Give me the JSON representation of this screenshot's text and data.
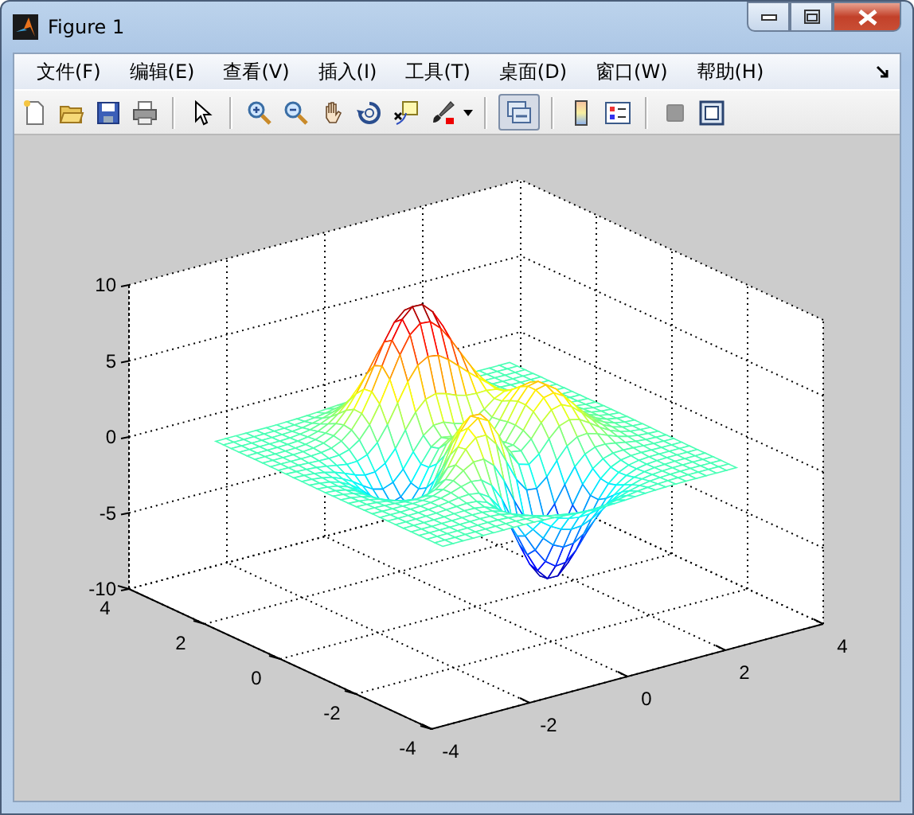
{
  "window": {
    "title": "Figure 1"
  },
  "menu": [
    {
      "label": "文件(F)"
    },
    {
      "label": "编辑(E)"
    },
    {
      "label": "查看(V)"
    },
    {
      "label": "插入(I)"
    },
    {
      "label": "工具(T)"
    },
    {
      "label": "桌面(D)"
    },
    {
      "label": "窗口(W)"
    },
    {
      "label": "帮助(H)"
    }
  ],
  "toolbar": [
    {
      "kind": "new",
      "pressed": false
    },
    {
      "kind": "open",
      "pressed": false
    },
    {
      "kind": "save",
      "pressed": false
    },
    {
      "kind": "print",
      "pressed": false
    },
    {
      "kind": "separator"
    },
    {
      "kind": "pointer",
      "pressed": false
    },
    {
      "kind": "separator"
    },
    {
      "kind": "zoom-in",
      "pressed": false
    },
    {
      "kind": "zoom-out",
      "pressed": false
    },
    {
      "kind": "pan",
      "pressed": false
    },
    {
      "kind": "rotate",
      "pressed": false
    },
    {
      "kind": "data-cursor",
      "pressed": false
    },
    {
      "kind": "brush",
      "pressed": false
    },
    {
      "kind": "separator"
    },
    {
      "kind": "link",
      "pressed": true
    },
    {
      "kind": "separator"
    },
    {
      "kind": "colorbar",
      "pressed": false
    },
    {
      "kind": "legend",
      "pressed": false
    },
    {
      "kind": "separator"
    },
    {
      "kind": "hide-tools",
      "pressed": false
    },
    {
      "kind": "show-tools",
      "pressed": false
    }
  ],
  "axes": {
    "z_ticks": [
      "10",
      "5",
      "0",
      "-5",
      "-10"
    ],
    "y_ticks": [
      "4",
      "2",
      "0",
      "-2",
      "-4"
    ],
    "x_ticks": [
      "-4",
      "-2",
      "0",
      "2",
      "4"
    ]
  }
}
